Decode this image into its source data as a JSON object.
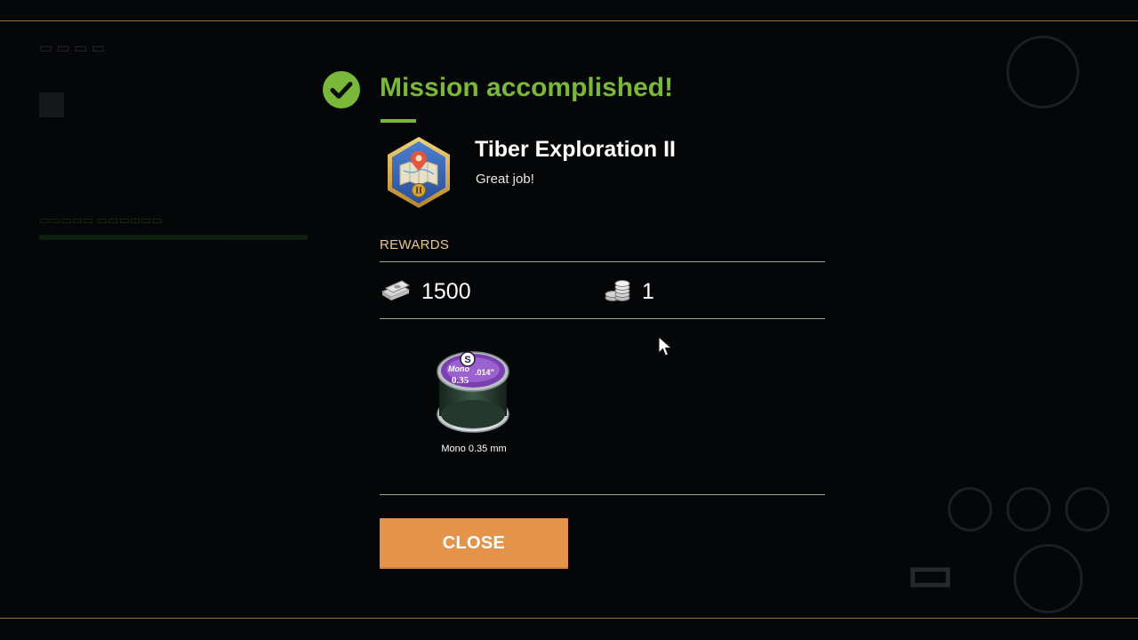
{
  "dialog": {
    "title": "Mission accomplished!",
    "mission_name": "Tiber Exploration II",
    "mission_subtitle": "Great job!",
    "rewards_label": "REWARDS",
    "money_value": "1500",
    "coins_value": "1",
    "item_name": "Mono 0.35 mm",
    "item_spool_brand": "Mono",
    "item_spool_size": "0.35",
    "item_spool_inch": ".014\"",
    "badge_roman": "II",
    "close_label": "CLOSE"
  },
  "icons": {
    "check": "checkmark-circle-icon",
    "badge": "map-pin-badge-icon",
    "money": "banknotes-icon",
    "coins": "coin-stack-icon",
    "cursor": "mouse-cursor-icon"
  },
  "colors": {
    "accent_green": "#7ab83a",
    "rewards_gold": "#e8c98a",
    "button_orange": "#e3934a",
    "background": "#050607"
  }
}
